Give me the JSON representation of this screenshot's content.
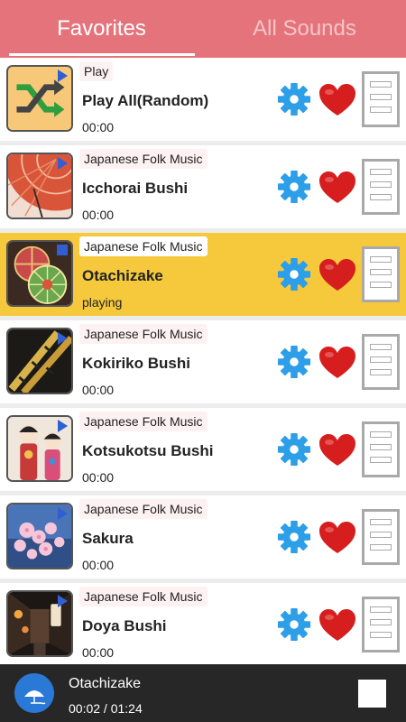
{
  "tabs": {
    "favorites": "Favorites",
    "all_sounds": "All Sounds"
  },
  "colors": {
    "tab_bar": "#e5737b",
    "active_row": "#f5c93b",
    "player_bar": "#272727",
    "gear": "#2d9ee8",
    "heart": "#d61e1e"
  },
  "rows": [
    {
      "category": "Play",
      "title": "Play All(Random)",
      "time": "00:00",
      "thumb": "shuffle-icon",
      "state": "idle"
    },
    {
      "category": "Japanese Folk Music",
      "title": "Icchorai Bushi",
      "time": "00:00",
      "thumb": "umbrella",
      "state": "idle"
    },
    {
      "category": "Japanese Folk Music",
      "title": "Otachizake",
      "time": "playing",
      "thumb": "temari-balls",
      "state": "playing"
    },
    {
      "category": "Japanese Folk Music",
      "title": "Kokiriko Bushi",
      "time": "00:00",
      "thumb": "bamboo-flute",
      "state": "idle"
    },
    {
      "category": "Japanese Folk Music",
      "title": "Kotsukotsu Bushi",
      "time": "00:00",
      "thumb": "kokeshi-dolls",
      "state": "idle"
    },
    {
      "category": "Japanese Folk Music",
      "title": "Sakura",
      "time": "00:00",
      "thumb": "cherry-blossoms",
      "state": "idle"
    },
    {
      "category": "Japanese Folk Music",
      "title": "Doya Bushi",
      "time": "00:00",
      "thumb": "night-alley",
      "state": "idle"
    }
  ],
  "player": {
    "title": "Otachizake",
    "time": "00:02 / 01:24",
    "progress_fraction": 0.024
  }
}
